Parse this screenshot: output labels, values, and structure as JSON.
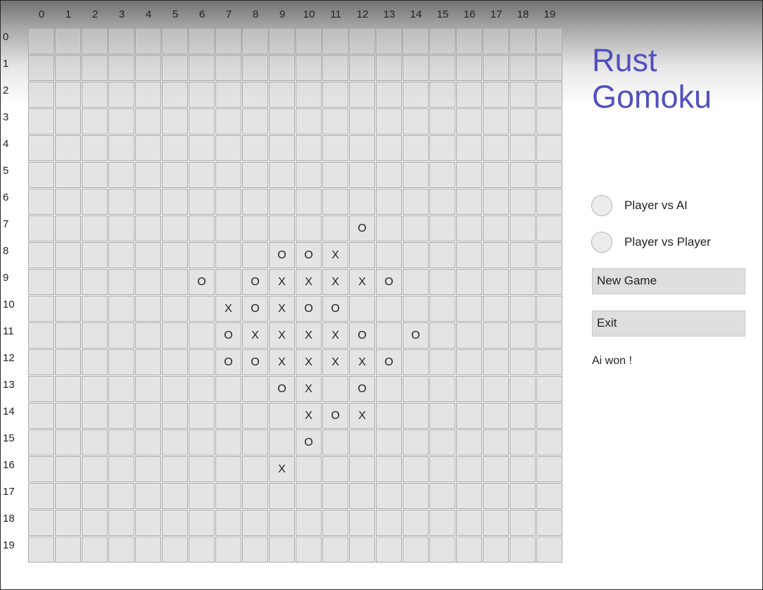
{
  "app": {
    "title_line1": "Rust",
    "title_line2": "Gomoku",
    "title_color": "#5050c0"
  },
  "board": {
    "size": 20,
    "col_labels": [
      "0",
      "1",
      "2",
      "3",
      "4",
      "5",
      "6",
      "7",
      "8",
      "9",
      "10",
      "11",
      "12",
      "13",
      "14",
      "15",
      "16",
      "17",
      "18",
      "19"
    ],
    "row_labels": [
      "0",
      "1",
      "2",
      "3",
      "4",
      "5",
      "6",
      "7",
      "8",
      "9",
      "10",
      "11",
      "12",
      "13",
      "14",
      "15",
      "16",
      "17",
      "18",
      "19"
    ],
    "stones": [
      {
        "row": 7,
        "col": 12,
        "mark": "O"
      },
      {
        "row": 8,
        "col": 9,
        "mark": "O"
      },
      {
        "row": 8,
        "col": 10,
        "mark": "O"
      },
      {
        "row": 8,
        "col": 11,
        "mark": "X"
      },
      {
        "row": 9,
        "col": 6,
        "mark": "O"
      },
      {
        "row": 9,
        "col": 8,
        "mark": "O"
      },
      {
        "row": 9,
        "col": 9,
        "mark": "X"
      },
      {
        "row": 9,
        "col": 10,
        "mark": "X"
      },
      {
        "row": 9,
        "col": 11,
        "mark": "X"
      },
      {
        "row": 9,
        "col": 12,
        "mark": "X"
      },
      {
        "row": 9,
        "col": 13,
        "mark": "O"
      },
      {
        "row": 10,
        "col": 7,
        "mark": "X"
      },
      {
        "row": 10,
        "col": 8,
        "mark": "O"
      },
      {
        "row": 10,
        "col": 9,
        "mark": "X"
      },
      {
        "row": 10,
        "col": 10,
        "mark": "O"
      },
      {
        "row": 10,
        "col": 11,
        "mark": "O"
      },
      {
        "row": 11,
        "col": 7,
        "mark": "O"
      },
      {
        "row": 11,
        "col": 8,
        "mark": "X"
      },
      {
        "row": 11,
        "col": 9,
        "mark": "X"
      },
      {
        "row": 11,
        "col": 10,
        "mark": "X"
      },
      {
        "row": 11,
        "col": 11,
        "mark": "X"
      },
      {
        "row": 11,
        "col": 12,
        "mark": "O"
      },
      {
        "row": 11,
        "col": 14,
        "mark": "O"
      },
      {
        "row": 12,
        "col": 7,
        "mark": "O"
      },
      {
        "row": 12,
        "col": 8,
        "mark": "O"
      },
      {
        "row": 12,
        "col": 9,
        "mark": "X"
      },
      {
        "row": 12,
        "col": 10,
        "mark": "X"
      },
      {
        "row": 12,
        "col": 11,
        "mark": "X"
      },
      {
        "row": 12,
        "col": 12,
        "mark": "X"
      },
      {
        "row": 12,
        "col": 13,
        "mark": "O"
      },
      {
        "row": 13,
        "col": 9,
        "mark": "O"
      },
      {
        "row": 13,
        "col": 10,
        "mark": "X"
      },
      {
        "row": 13,
        "col": 12,
        "mark": "O"
      },
      {
        "row": 14,
        "col": 10,
        "mark": "X"
      },
      {
        "row": 14,
        "col": 11,
        "mark": "O"
      },
      {
        "row": 14,
        "col": 12,
        "mark": "X"
      },
      {
        "row": 15,
        "col": 10,
        "mark": "O"
      },
      {
        "row": 16,
        "col": 9,
        "mark": "X"
      }
    ]
  },
  "mode": {
    "options": [
      {
        "label": "Player vs AI",
        "selected": false
      },
      {
        "label": "Player vs Player",
        "selected": false
      }
    ]
  },
  "buttons": {
    "new_game": "New Game",
    "exit": "Exit"
  },
  "status": {
    "message": "Ai won !"
  }
}
